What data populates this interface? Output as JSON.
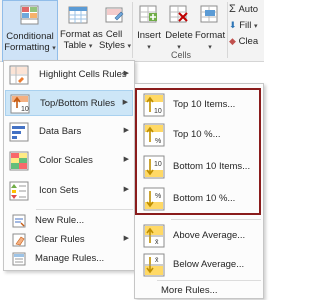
{
  "ribbon": {
    "conditional_formatting": {
      "line1": "Conditional",
      "line2": "Formatting"
    },
    "format_as_table": {
      "line1": "Format as",
      "line2": "Table"
    },
    "cell_styles": {
      "line1": "Cell",
      "line2": "Styles"
    },
    "insert": "Insert",
    "delete": "Delete",
    "format": "Format",
    "cells_group": "Cells",
    "autosum": "Auto",
    "fill": "Fill",
    "clear": "Clea"
  },
  "menu": {
    "items": [
      {
        "label": "Highlight Cells Rules",
        "icon": "highlight-cells-icon",
        "submenu": true
      },
      {
        "label": "Top/Bottom Rules",
        "icon": "top-bottom-icon",
        "submenu": true,
        "active": true
      },
      {
        "label": "Data Bars",
        "icon": "data-bars-icon",
        "submenu": true
      },
      {
        "label": "Color Scales",
        "icon": "color-scales-icon",
        "submenu": true
      },
      {
        "label": "Icon Sets",
        "icon": "icon-sets-icon",
        "submenu": true
      }
    ],
    "commands": [
      {
        "label": "New Rule...",
        "icon": "new-rule-icon"
      },
      {
        "label": "Clear Rules",
        "icon": "clear-rules-icon",
        "submenu": true
      },
      {
        "label": "Manage Rules...",
        "icon": "manage-rules-icon"
      }
    ]
  },
  "submenu": {
    "items": [
      {
        "label": "Top 10 Items...",
        "icon_text": "10"
      },
      {
        "label": "Top 10 %...",
        "icon_text": "%"
      },
      {
        "label": "Bottom 10 Items...",
        "icon_text": "10"
      },
      {
        "label": "Bottom 10 %...",
        "icon_text": "%"
      },
      {
        "label": "Above Average...",
        "icon_text": "x̄"
      },
      {
        "label": "Below Average...",
        "icon_text": "x̄"
      }
    ],
    "more_rules": "More Rules..."
  },
  "colors": {
    "highlight_border": "#8a1c1c",
    "active_item": "#cde6f7",
    "ribbon": "#f3f3f3"
  }
}
